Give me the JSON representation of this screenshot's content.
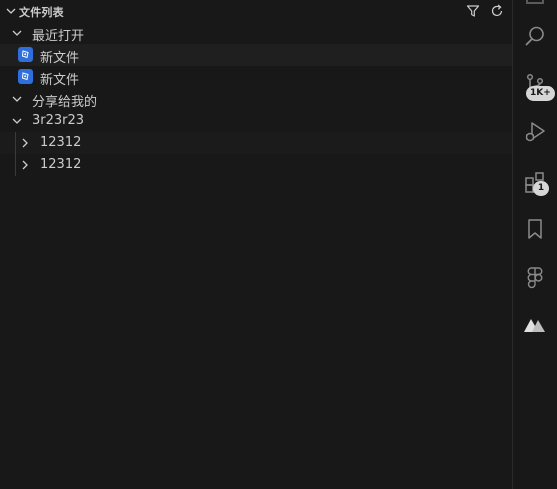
{
  "header": {
    "title": "文件列表",
    "filter_icon": "filter-icon",
    "refresh_icon": "refresh-icon"
  },
  "tree": {
    "recent": {
      "label": "最近打开",
      "items": [
        {
          "label": "新文件",
          "icon": "design-file-icon"
        },
        {
          "label": "新文件",
          "icon": "design-file-icon"
        }
      ]
    },
    "shared": {
      "label": "分享给我的"
    },
    "project": {
      "label": "3r23r23",
      "children": [
        {
          "label": "12312"
        },
        {
          "label": "12312"
        }
      ]
    }
  },
  "activity_bar": {
    "items": [
      {
        "icon": "search-icon"
      },
      {
        "icon": "source-control-icon",
        "badge": "1K+"
      },
      {
        "icon": "run-debug-icon"
      },
      {
        "icon": "extensions-icon",
        "badge": "1"
      },
      {
        "icon": "bookmark-icon"
      },
      {
        "icon": "figma-icon"
      },
      {
        "icon": "mastergo-icon"
      }
    ]
  },
  "colors": {
    "background": "#181818",
    "text": "#cccccc",
    "file_icon": "#2f6fdc",
    "badge": "#d6d6d6"
  }
}
